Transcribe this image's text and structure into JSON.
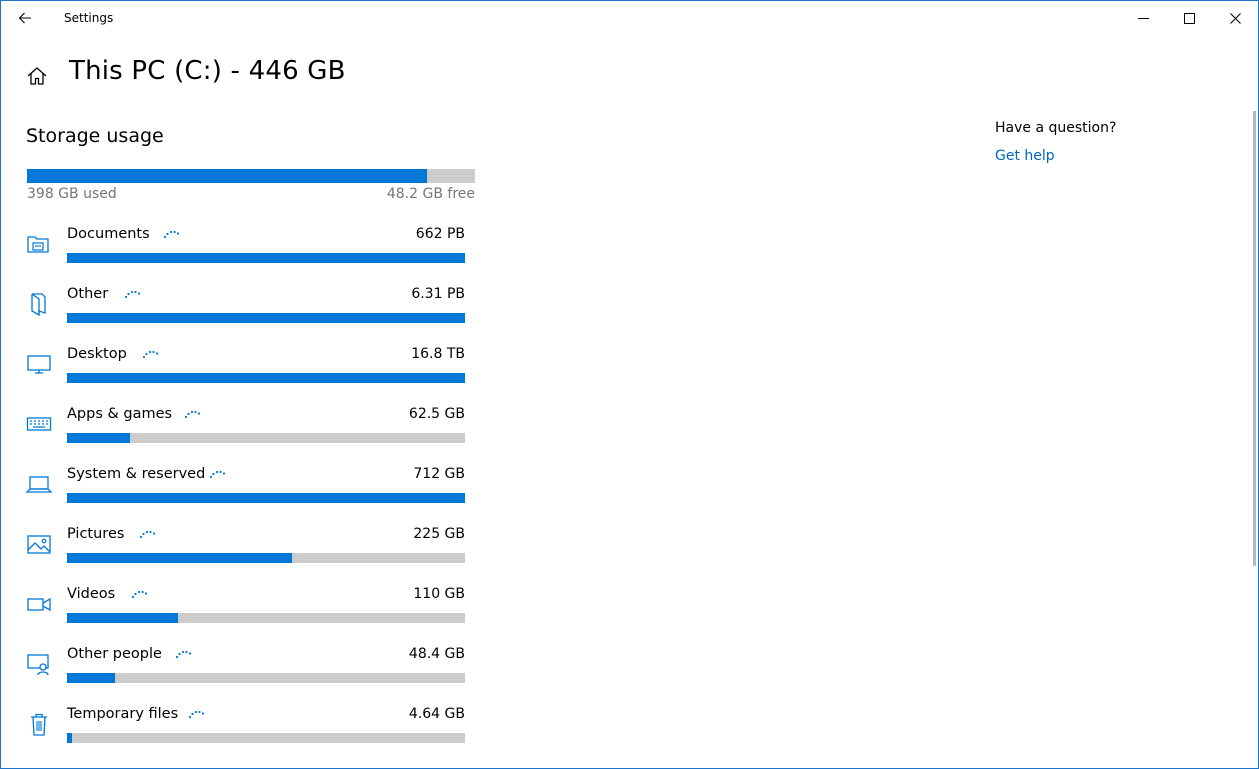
{
  "window": {
    "app_title": "Settings",
    "accent": "#0078d7",
    "border": "#1f73c9"
  },
  "header": {
    "title": "This PC (C:) - 446 GB"
  },
  "storage": {
    "section_title": "Storage usage",
    "used_label": "398 GB used",
    "free_label": "48.2 GB free",
    "used_fraction": 0.892
  },
  "categories": [
    {
      "name": "Documents",
      "size": "662 PB",
      "fraction": 1.0,
      "icon": "documents-folder-icon"
    },
    {
      "name": "Other",
      "size": "6.31 PB",
      "fraction": 1.0,
      "icon": "other-files-icon"
    },
    {
      "name": "Desktop",
      "size": "16.8 TB",
      "fraction": 1.0,
      "icon": "desktop-monitor-icon"
    },
    {
      "name": "Apps & games",
      "size": "62.5 GB",
      "fraction": 0.158,
      "icon": "keyboard-icon"
    },
    {
      "name": "System & reserved",
      "size": "712 GB",
      "fraction": 1.0,
      "icon": "laptop-icon"
    },
    {
      "name": "Pictures",
      "size": "225 GB",
      "fraction": 0.565,
      "icon": "picture-icon"
    },
    {
      "name": "Videos",
      "size": "110 GB",
      "fraction": 0.279,
      "icon": "video-camera-icon"
    },
    {
      "name": "Other people",
      "size": "48.4 GB",
      "fraction": 0.12,
      "icon": "other-people-icon"
    },
    {
      "name": "Temporary files",
      "size": "4.64 GB",
      "fraction": 0.012,
      "icon": "trash-icon"
    }
  ],
  "help": {
    "question": "Have a question?",
    "link": "Get help"
  }
}
